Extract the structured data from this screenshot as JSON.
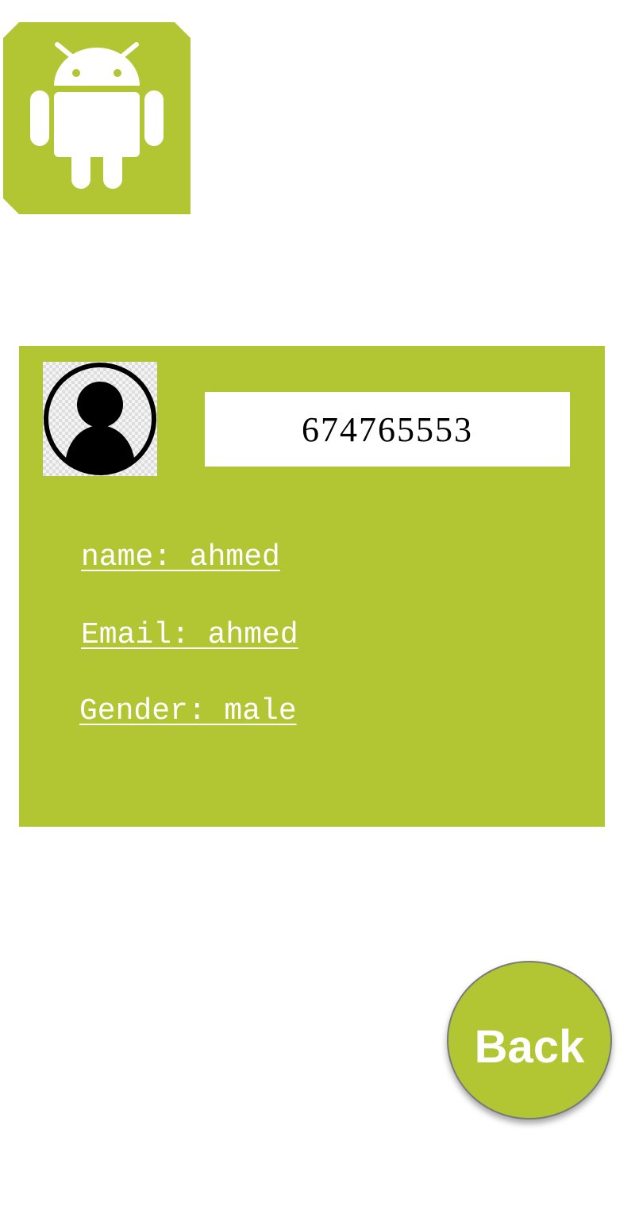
{
  "app": {
    "logo_icon": "android-logo-icon",
    "accent_color": "#b2c634"
  },
  "card": {
    "avatar_icon": "user-avatar-icon",
    "id_value": "674765553",
    "name_line": "name: ahmed",
    "email_line": "Email: ahmed",
    "gender_line": "Gender: male"
  },
  "actions": {
    "back_label": "Back"
  }
}
